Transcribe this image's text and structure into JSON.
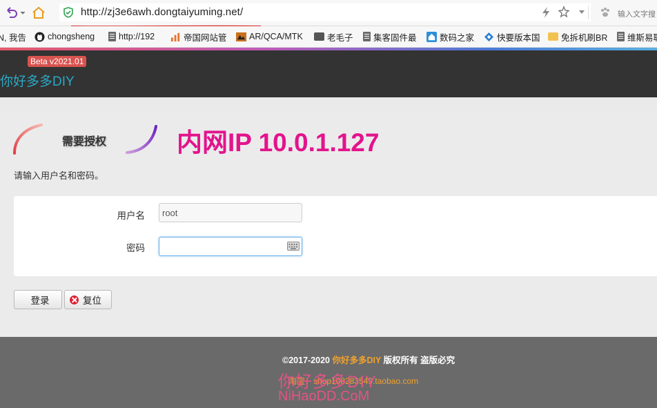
{
  "browser": {
    "url": "http://zj3e6awh.dongtaiyuming.net/",
    "search_placeholder": "输入文字搜",
    "bookmarks": [
      {
        "label": "N, 我告",
        "icon": "text-fragment"
      },
      {
        "label": "chongsheng",
        "icon": "github-icon"
      },
      {
        "label": "http://192",
        "icon": "page-icon"
      },
      {
        "label": "帝国网站管",
        "icon": "site-logo-icon"
      },
      {
        "label": "AR/QCA/MTK",
        "icon": "app-icon"
      },
      {
        "label": "老毛子",
        "icon": "folder-icon"
      },
      {
        "label": "集客固件最",
        "icon": "page-icon"
      },
      {
        "label": "数码之家",
        "icon": "home-site-icon"
      },
      {
        "label": "快要版本国",
        "icon": "diamond-site-icon"
      },
      {
        "label": "免拆机刷BR",
        "icon": "folder-icon"
      },
      {
        "label": "维斯易联",
        "icon": "page-icon"
      }
    ]
  },
  "header": {
    "beta": "Beta v2021.01",
    "brand": "你好多多DIY"
  },
  "auth": {
    "title": "需要授权",
    "ip_banner": "内网IP 10.0.1.127",
    "prompt": "请输入用户名和密码。",
    "username_label": "用户名",
    "username_value": "root",
    "password_label": "密码",
    "login_button": "登录",
    "reset_button": "复位"
  },
  "footer": {
    "copyright_prefix": "©2017-2020",
    "copyright_brand": "你好多多DIY",
    "copyright_suffix": "版权所有 盗版必究",
    "shop": "淘宝：shop108283549.taobao.com",
    "watermark_cn": "你好多多DIY",
    "watermark_en": "NiHaoDD.CoM"
  },
  "colors": {
    "header_bg": "#333333",
    "brand": "#2aa9c6",
    "beta_badge": "#d9534f",
    "ip_banner": "#e3138c",
    "footer_bg": "#6a6a6a",
    "footer_accent": "#f0a22e",
    "url_underline": "#d62828"
  }
}
